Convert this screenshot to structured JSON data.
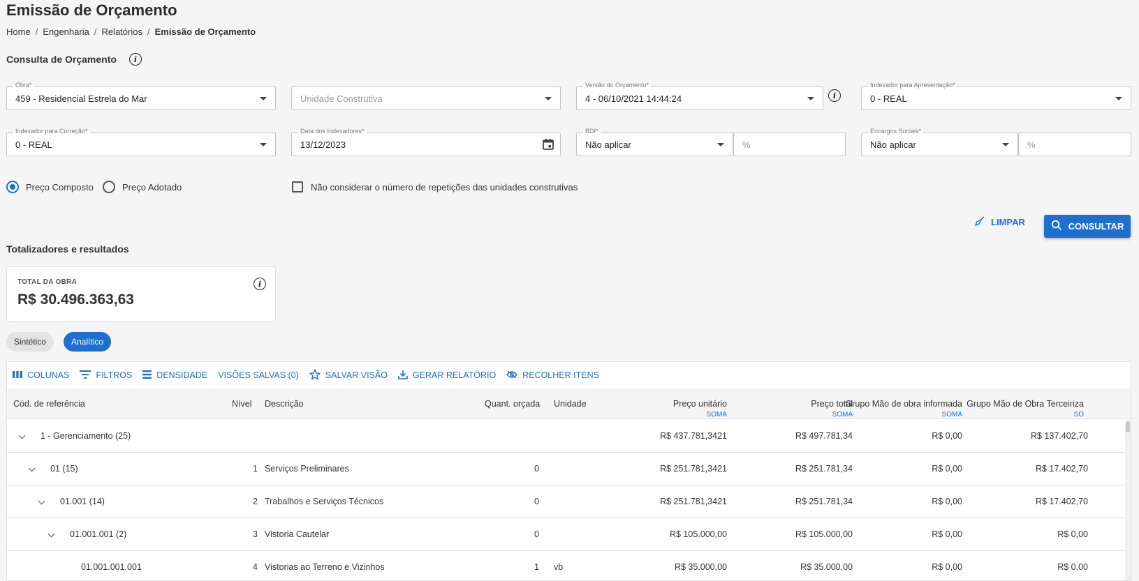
{
  "page": {
    "title": "Emissão de Orçamento"
  },
  "breadcrumb": [
    "Home",
    "Engenharia",
    "Relatórios",
    "Emissão de Orçamento"
  ],
  "query_section": {
    "title": "Consulta de Orçamento",
    "info_icon": "info-icon"
  },
  "fields": {
    "obra": {
      "label": "Obra*",
      "value": "459 - Residencial Estrela do Mar"
    },
    "unidade": {
      "placeholder": "Unidade Construtiva"
    },
    "versao": {
      "label": "Versão do Orçamento*",
      "value": "4 - 06/10/2021 14:44:24"
    },
    "indexador_apresentacao": {
      "label": "Indexador para Apresentação*",
      "value": "0 - REAL"
    },
    "indexador_correcao": {
      "label": "Indexador para Correção*",
      "value": "0 - REAL"
    },
    "data_indexadores": {
      "label": "Data dos Indexadores*",
      "value": "13/12/2023"
    },
    "bdi": {
      "label": "BDI*",
      "value": "Não aplicar",
      "percent_placeholder": "%"
    },
    "encargos": {
      "label": "Encargos Sociais*",
      "value": "Não aplicar",
      "percent_placeholder": "%"
    }
  },
  "price_options": {
    "composto": "Preço Composto",
    "adotado": "Preço Adotado",
    "selected": "composto"
  },
  "checkbox_label": "Não considerar o número de repetições das unidades construtivas",
  "actions": {
    "limpar": "LIMPAR",
    "consultar": "CONSULTAR"
  },
  "results": {
    "title": "Totalizadores e resultados",
    "total_label": "TOTAL DA OBRA",
    "total_value": "R$ 30.496.363,63"
  },
  "view_toggle": {
    "sintetico": "Sintético",
    "analitico": "Analítico",
    "selected": "analitico"
  },
  "toolbar": {
    "colunas": "COLUNAS",
    "filtros": "FILTROS",
    "densidade": "DENSIDADE",
    "visoes": "VISÕES SALVAS (0)",
    "salvar": "SALVAR VISÃO",
    "gerar": "GERAR RELATÓRIO",
    "recolher": "RECOLHER ITENS"
  },
  "columns": {
    "cod": "Cód. de referência",
    "nivel": "Nível",
    "descricao": "Descrição",
    "quant": "Quant. orçada",
    "unidade": "Unidade",
    "preco_unit": "Preço unitário",
    "preco_total": "Preço total",
    "grupo_mo": "Grupo Mão de obra informada",
    "grupo_terc": "Grupo Mão de Obra Terceiriza",
    "soma": "SOMA",
    "soma_cut": "SOMA",
    "soma_cut2": "SO"
  },
  "rows": [
    {
      "cod": "1 - Gerenciamento (25)",
      "nivel": "",
      "descricao": "",
      "quant": "",
      "unidade": "",
      "preco_unit": "R$ 437.781,3421",
      "preco_total": "R$ 497.781,34",
      "grupo_mo": "R$ 0,00",
      "grupo_terc": "R$ 137.402,70"
    },
    {
      "cod": "01 (15)",
      "nivel": "1",
      "descricao": "Serviços Preliminares",
      "quant": "0",
      "unidade": "",
      "preco_unit": "R$ 251.781,3421",
      "preco_total": "R$ 251.781,34",
      "grupo_mo": "R$ 0,00",
      "grupo_terc": "R$ 17.402,70"
    },
    {
      "cod": "01.001 (14)",
      "nivel": "2",
      "descricao": "Trabalhos e Serviços Técnicos",
      "quant": "0",
      "unidade": "",
      "preco_unit": "R$ 251.781,3421",
      "preco_total": "R$ 251.781,34",
      "grupo_mo": "R$ 0,00",
      "grupo_terc": "R$ 17.402,70"
    },
    {
      "cod": "01.001.001 (2)",
      "nivel": "3",
      "descricao": "Vistoria Cautelar",
      "quant": "0",
      "unidade": "",
      "preco_unit": "R$ 105.000,00",
      "preco_total": "R$ 105.000,00",
      "grupo_mo": "R$ 0,00",
      "grupo_terc": "R$ 0,00"
    },
    {
      "cod": "01.001.001.001",
      "nivel": "4",
      "descricao": "Vistorias ao Terreno e Vizinhos",
      "quant": "1",
      "unidade": "vb",
      "preco_unit": "R$ 35.000,00",
      "preco_total": "R$ 35.000,00",
      "grupo_mo": "R$ 0,00",
      "grupo_terc": "R$ 0,00"
    }
  ]
}
